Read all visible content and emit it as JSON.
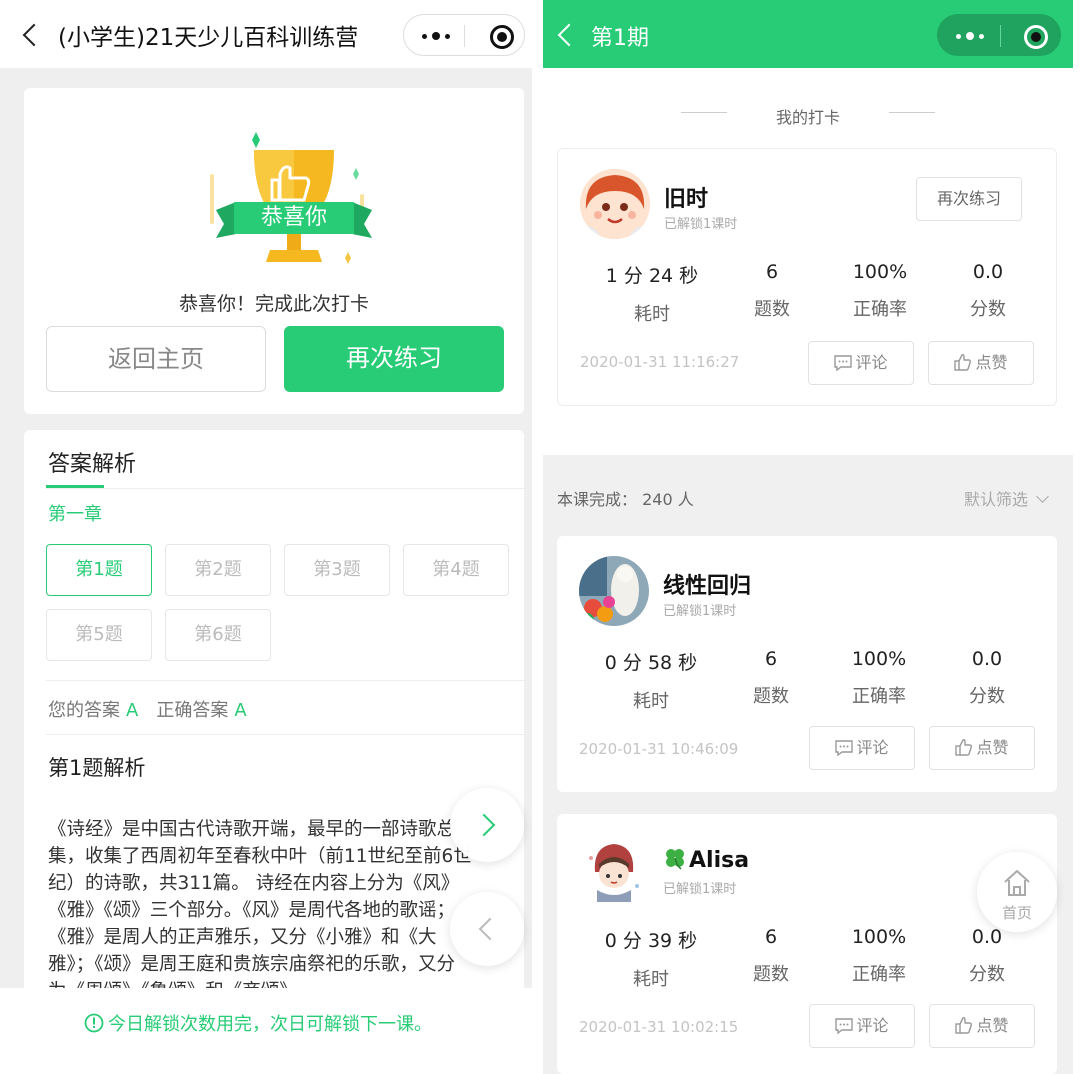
{
  "left": {
    "header": {
      "title": "(小学生)21天少儿百科训练营"
    },
    "result": {
      "ribbon": "恭喜你",
      "message": "恭喜你！完成此次打卡",
      "home_button": "返回主页",
      "again_button": "再次练习"
    },
    "analysis": {
      "section_title": "答案解析",
      "chapter": "第一章",
      "questions": [
        "第1题",
        "第2题",
        "第3题",
        "第4题",
        "第5题",
        "第6题"
      ],
      "your_answer_label": "您的答案",
      "your_answer": "A",
      "correct_answer_label": "正确答案",
      "correct_answer": "A",
      "detail_title": "第1题解析",
      "detail_lines": [
        "《诗经》是中国古代诗歌开端，最早的一部诗歌总",
        "集，收集了西周初年至春秋中叶（前11世纪至前6世",
        "纪）的诗歌，共311篇。 诗经在内容上分为《风》",
        "《雅》《颂》三个部分。《风》是周代各地的歌谣；",
        "《雅》是周人的正声雅乐，又分《小雅》和《大",
        "雅》；《颂》是周王庭和贵族宗庙祭祀的乐歌，又分",
        "为《周颂》《鲁颂》和《商颂》。"
      ]
    },
    "notice": "今日解锁次数用完，次日可解锁下一课。"
  },
  "right": {
    "header": {
      "title": "第1期"
    },
    "my_checkin_label": "我的打卡",
    "me": {
      "name": "旧时",
      "unlock": "已解锁1课时",
      "again": "再次练习",
      "stats": [
        {
          "value": "1 分 24 秒",
          "label": "耗时"
        },
        {
          "value": "6",
          "label": "题数"
        },
        {
          "value": "100%",
          "label": "正确率"
        },
        {
          "value": "0.0",
          "label": "分数"
        }
      ],
      "date": "2020-01-31 11:16:27",
      "comment": "评论",
      "like": "点赞"
    },
    "complete_count": "本课完成： 240 人",
    "filter": "默认筛选",
    "others": [
      {
        "name": "线性回归",
        "unlock": "已解锁1课时",
        "stats": [
          {
            "value": "0 分 58 秒",
            "label": "耗时"
          },
          {
            "value": "6",
            "label": "题数"
          },
          {
            "value": "100%",
            "label": "正确率"
          },
          {
            "value": "0.0",
            "label": "分数"
          }
        ],
        "date": "2020-01-31 10:46:09",
        "comment": "评论",
        "like": "点赞"
      },
      {
        "name": "Alisa",
        "name_prefix_icon": "clover-icon",
        "unlock": "已解锁1课时",
        "stats": [
          {
            "value": "0 分 39 秒",
            "label": "耗时"
          },
          {
            "value": "6",
            "label": "题数"
          },
          {
            "value": "100%",
            "label": "正确率"
          },
          {
            "value": "0.0",
            "label": "分数"
          }
        ],
        "date": "2020-01-31 10:02:15",
        "comment": "评论",
        "like": "点赞"
      }
    ],
    "home_float": "首页"
  },
  "colors": {
    "accent": "#29cc76",
    "gold": "#f4b400",
    "gray_bg": "#efefef"
  }
}
